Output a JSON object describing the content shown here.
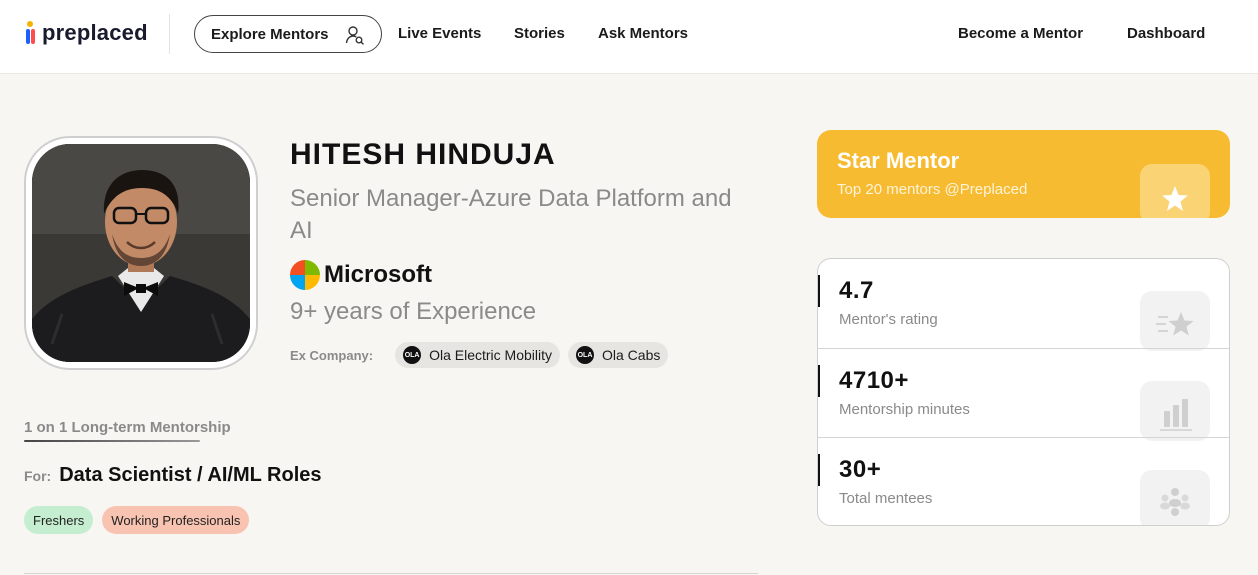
{
  "header": {
    "logo_text": "preplaced",
    "nav": {
      "explore_mentors": "Explore Mentors",
      "live_events": "Live Events",
      "stories": "Stories",
      "ask_mentors": "Ask Mentors",
      "become_mentor": "Become a Mentor",
      "dashboard": "Dashboard"
    }
  },
  "profile": {
    "name": "HITESH HINDUJA",
    "role": "Senior Manager-Azure Data Platform and AI",
    "company": "Microsoft",
    "experience": "9+ years of Experience",
    "ex_company_label": "Ex Company:",
    "ex_companies": [
      {
        "name": "Ola Electric Mobility",
        "logo_text": "OLA"
      },
      {
        "name": "Ola Cabs",
        "logo_text": "OLA"
      }
    ]
  },
  "program": {
    "title": "1 on 1 Long-term Mentorship",
    "for_label": "For:",
    "for_value": "Data Scientist / AI/ML Roles",
    "tags": [
      "Freshers",
      "Working Professionals"
    ]
  },
  "star_card": {
    "title": "Star Mentor",
    "subtitle": "Top 20 mentors @Preplaced"
  },
  "stats": [
    {
      "value": "4.7",
      "label": "Mentor's rating",
      "icon": "star-rating-icon"
    },
    {
      "value": "4710+",
      "label": "Mentorship minutes",
      "icon": "bar-chart-icon"
    },
    {
      "value": "30+",
      "label": "Total mentees",
      "icon": "people-icon"
    }
  ],
  "colors": {
    "star_card_bg": "#f7bb31",
    "tag_green": "#c5edd0",
    "tag_pink": "#f9c3b2",
    "page_bg": "#f8f6f3"
  }
}
